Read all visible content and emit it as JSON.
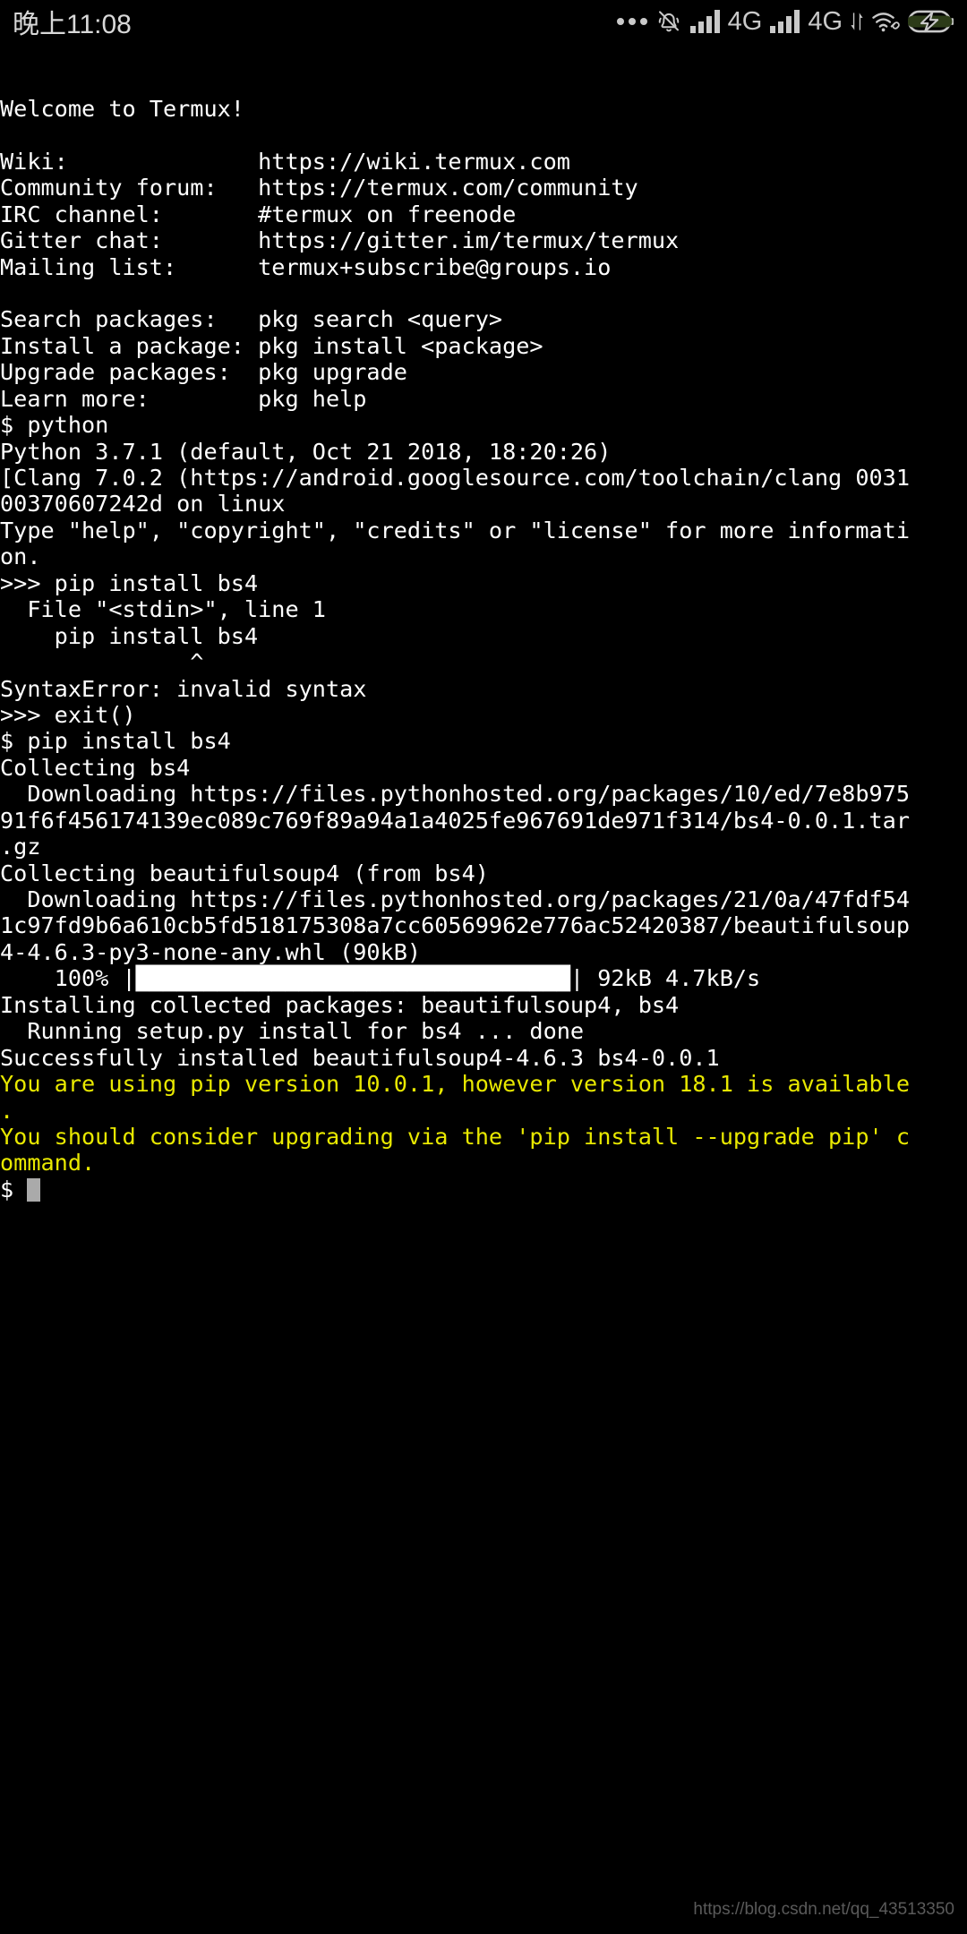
{
  "status_bar": {
    "clock": "晚上11:08",
    "icons": [
      {
        "name": "more-notifications-icon",
        "glyph": "dots"
      },
      {
        "name": "silent-mode-icon",
        "glyph": "bell-slash"
      },
      {
        "name": "signal-bars-sim1-icon",
        "glyph": "bars"
      },
      {
        "name": "network-type-sim1-label",
        "glyph": "text",
        "text": "4G"
      },
      {
        "name": "signal-bars-sim2-icon",
        "glyph": "bars"
      },
      {
        "name": "network-type-sim2-label",
        "glyph": "text",
        "text": "4G"
      },
      {
        "name": "data-transfer-icon",
        "glyph": "updown"
      },
      {
        "name": "wifi-icon",
        "glyph": "wifi"
      },
      {
        "name": "battery-charging-icon",
        "glyph": "battery"
      }
    ],
    "network_label_1": "4G",
    "network_label_2": "4G"
  },
  "terminal": {
    "colors": {
      "background": "#000000",
      "foreground": "#ffffff",
      "warning": "#e8e800",
      "cursor": "#aaaaaa"
    },
    "lines": [
      {
        "text": "Welcome to Termux!",
        "color": "white"
      },
      {
        "text": "",
        "color": "white"
      },
      {
        "text": "Wiki:              https://wiki.termux.com",
        "color": "white"
      },
      {
        "text": "Community forum:   https://termux.com/community",
        "color": "white"
      },
      {
        "text": "IRC channel:       #termux on freenode",
        "color": "white"
      },
      {
        "text": "Gitter chat:       https://gitter.im/termux/termux",
        "color": "white"
      },
      {
        "text": "Mailing list:      termux+subscribe@groups.io",
        "color": "white"
      },
      {
        "text": "",
        "color": "white"
      },
      {
        "text": "Search packages:   pkg search <query>",
        "color": "white"
      },
      {
        "text": "Install a package: pkg install <package>",
        "color": "white"
      },
      {
        "text": "Upgrade packages:  pkg upgrade",
        "color": "white"
      },
      {
        "text": "Learn more:        pkg help",
        "color": "white"
      },
      {
        "text": "$ python",
        "color": "white"
      },
      {
        "text": "Python 3.7.1 (default, Oct 21 2018, 18:20:26)",
        "color": "white"
      },
      {
        "text": "[Clang 7.0.2 (https://android.googlesource.com/toolchain/clang 0031",
        "color": "white"
      },
      {
        "text": "00370607242d on linux",
        "color": "white"
      },
      {
        "text": "Type \"help\", \"copyright\", \"credits\" or \"license\" for more informati",
        "color": "white"
      },
      {
        "text": "on.",
        "color": "white"
      },
      {
        "text": ">>> pip install bs4",
        "color": "white"
      },
      {
        "text": "  File \"<stdin>\", line 1",
        "color": "white"
      },
      {
        "text": "    pip install bs4",
        "color": "white"
      },
      {
        "text": "              ^",
        "color": "white"
      },
      {
        "text": "SyntaxError: invalid syntax",
        "color": "white"
      },
      {
        "text": ">>> exit()",
        "color": "white"
      },
      {
        "text": "$ pip install bs4",
        "color": "white"
      },
      {
        "text": "Collecting bs4",
        "color": "white"
      },
      {
        "text": "  Downloading https://files.pythonhosted.org/packages/10/ed/7e8b975",
        "color": "white"
      },
      {
        "text": "91f6f456174139ec089c769f89a94a1a4025fe967691de971f314/bs4-0.0.1.tar",
        "color": "white"
      },
      {
        "text": ".gz",
        "color": "white"
      },
      {
        "text": "Collecting beautifulsoup4 (from bs4)",
        "color": "white"
      },
      {
        "text": "  Downloading https://files.pythonhosted.org/packages/21/0a/47fdf54",
        "color": "white"
      },
      {
        "text": "1c97fd9b6a610cb5fd518175308a7cc60569962e776ac52420387/beautifulsoup",
        "color": "white"
      },
      {
        "text": "4-4.6.3-py3-none-any.whl (90kB)",
        "color": "white"
      },
      {
        "text": "    100% |████████████████████████████████| 92kB 4.7kB/s",
        "color": "white"
      },
      {
        "text": "Installing collected packages: beautifulsoup4, bs4",
        "color": "white"
      },
      {
        "text": "  Running setup.py install for bs4 ... done",
        "color": "white"
      },
      {
        "text": "Successfully installed beautifulsoup4-4.6.3 bs4-0.0.1",
        "color": "white"
      },
      {
        "text": "You are using pip version 10.0.1, however version 18.1 is available",
        "color": "yellow"
      },
      {
        "text": ".",
        "color": "yellow"
      },
      {
        "text": "You should consider upgrading via the 'pip install --upgrade pip' c",
        "color": "yellow"
      },
      {
        "text": "ommand.",
        "color": "yellow"
      }
    ],
    "prompt": "$ "
  },
  "watermark": {
    "text": "https://blog.csdn.net/qq_43513350"
  }
}
